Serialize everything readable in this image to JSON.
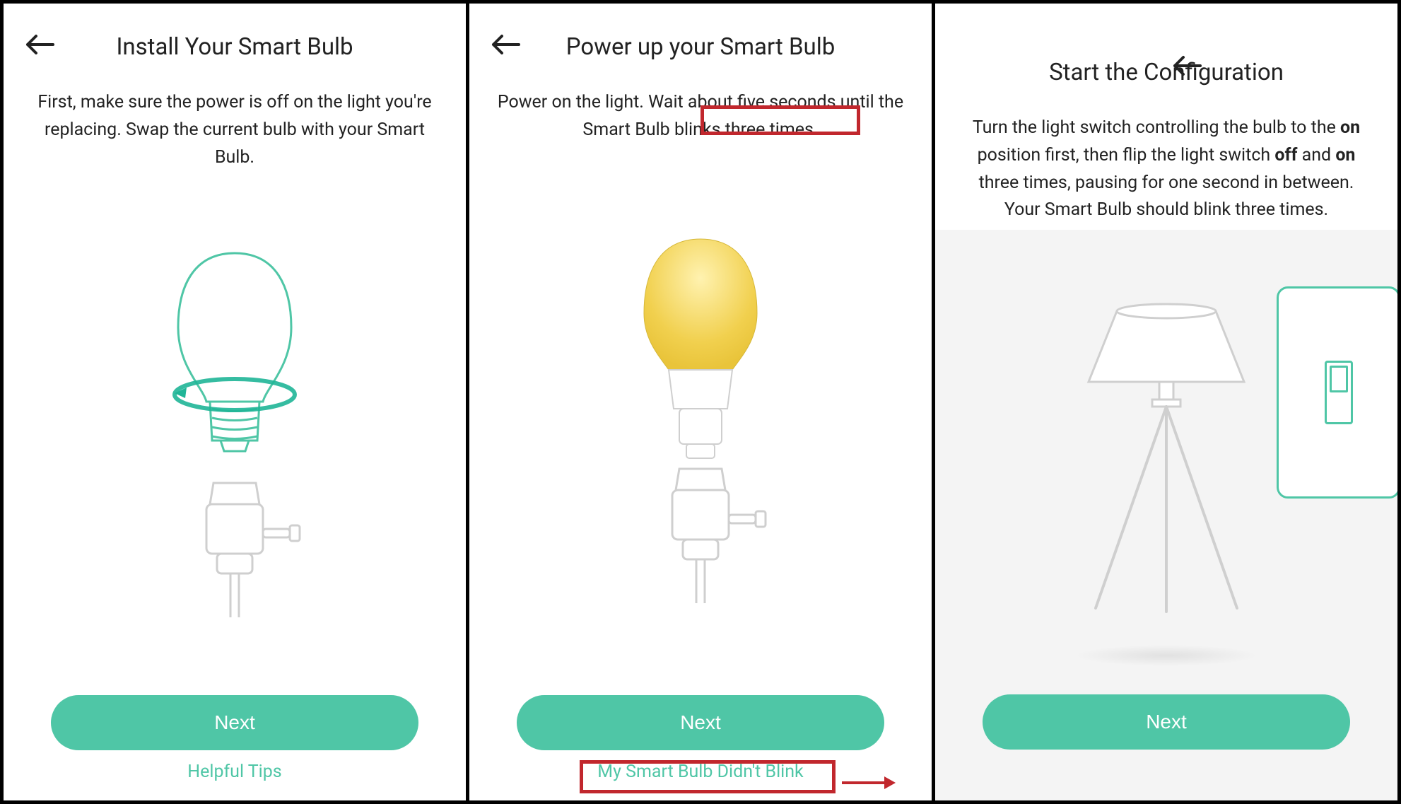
{
  "panel1": {
    "title": "Install Your Smart Bulb",
    "body": "First, make sure the power is off on the light you're replacing. Swap the current bulb with your Smart Bulb.",
    "next": "Next",
    "sublink": "Helpful Tips"
  },
  "panel2": {
    "title": "Power up your Smart Bulb",
    "body_before": "Power on the light. Wait about five seconds until the Smart Bulb ",
    "body_highlight": "blinks three times.",
    "next": "Next",
    "sublink": "My Smart Bulb Didn't Blink"
  },
  "panel3": {
    "title": "Start the Configuration",
    "body_html_parts": {
      "p1": "Turn the light switch controlling the bulb to the ",
      "b1": "on",
      "p2": " position first, then flip the light switch ",
      "b2": "off",
      "p3": " and ",
      "b3": "on",
      "p4": " three times, pausing for one second in between. Your Smart Bulb should blink three times."
    },
    "next": "Next"
  },
  "icons": {
    "back": "back-arrow-icon",
    "bulb_install": "bulb-install-illustration",
    "bulb_glow": "bulb-glowing-illustration",
    "lamp_switch": "lamp-switch-illustration"
  },
  "colors": {
    "accent": "#4fc6a6",
    "highlight": "#c1272d"
  }
}
